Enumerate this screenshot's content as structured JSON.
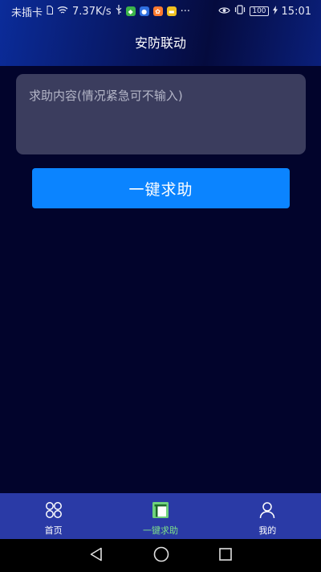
{
  "status_bar": {
    "carrier": "未插卡",
    "speed": "7.37K/s",
    "more": "···",
    "battery": "100",
    "time": "15:01"
  },
  "header": {
    "title": "安防联动"
  },
  "form": {
    "content_placeholder": "求助内容(情况紧急可不输入)",
    "content_value": "",
    "submit_label": "一键求助"
  },
  "bottom_nav": {
    "items": [
      {
        "label": "首页",
        "icon": "grid-circles-icon",
        "active": false
      },
      {
        "label": "一键求助",
        "icon": "help-panel-icon",
        "active": true
      },
      {
        "label": "我的",
        "icon": "user-icon",
        "active": false
      }
    ]
  },
  "colors": {
    "background": "#02042c",
    "input_bg": "#3b3d5e",
    "primary_button": "#0b84ff",
    "nav_bg": "#2a3aa6",
    "active_tab": "#7ee08a"
  }
}
